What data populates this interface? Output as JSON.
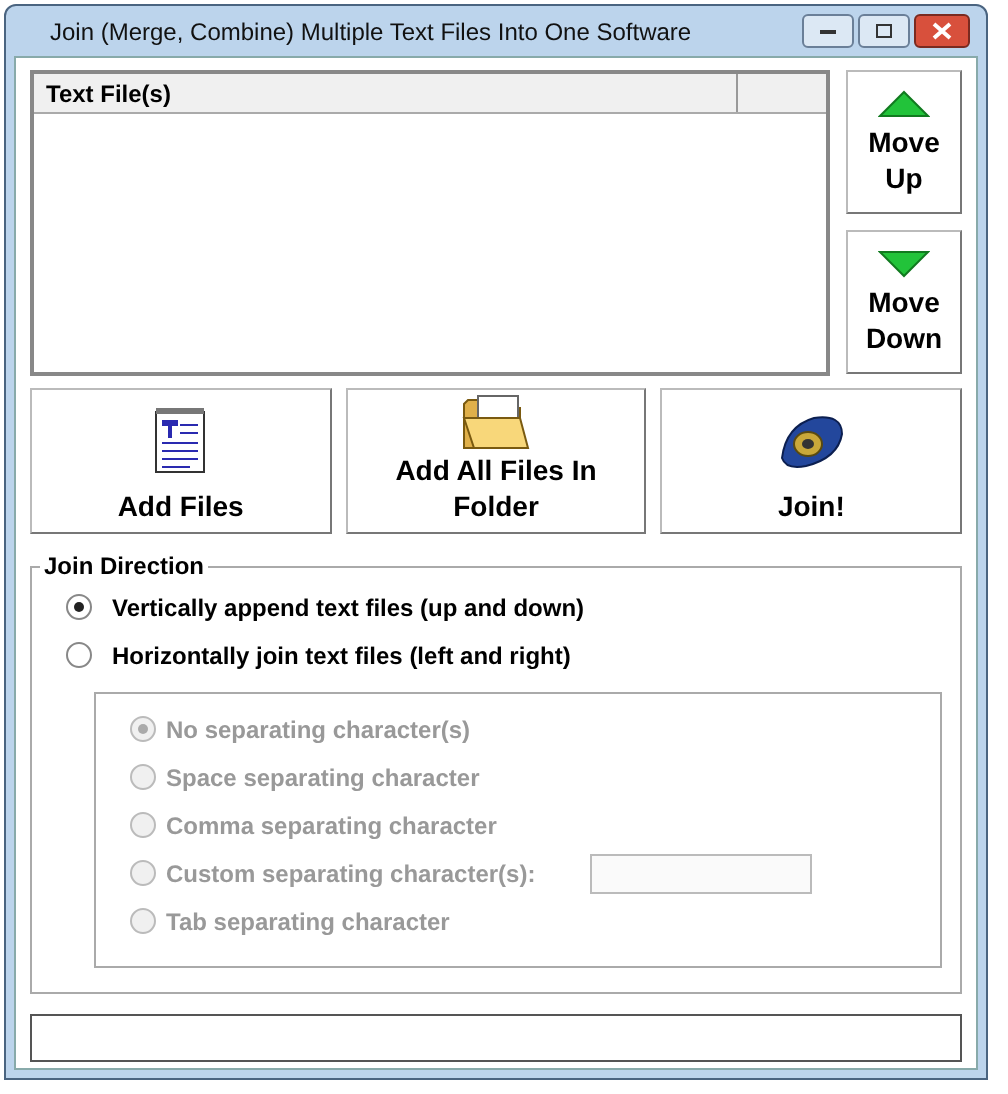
{
  "window": {
    "title": "Join (Merge, Combine) Multiple Text Files Into One Software"
  },
  "file_list": {
    "columns": [
      {
        "label": "Text File(s)"
      }
    ]
  },
  "side_buttons": [
    {
      "label": "Move Up",
      "kind": "up"
    },
    {
      "label": "Move Down",
      "kind": "down"
    }
  ],
  "action_buttons": [
    {
      "label": "Add Files",
      "kind": "document"
    },
    {
      "label": "Add All Files In Folder",
      "kind": "folder"
    },
    {
      "label": "Join!",
      "kind": "tape"
    }
  ],
  "join_direction": {
    "title": "Join Direction",
    "options": [
      {
        "label": "Vertically append text files (up and down)",
        "selected": true
      },
      {
        "label": "Horizontally join text files (left and right)",
        "selected": false
      }
    ]
  },
  "separators": {
    "disabled": true,
    "options": [
      {
        "label": "No separating character(s)",
        "selected": true,
        "kind": "plain"
      },
      {
        "label": "Space separating character",
        "selected": false,
        "kind": "plain"
      },
      {
        "label": "Comma separating character",
        "selected": false,
        "kind": "plain"
      },
      {
        "label": "Custom separating character(s):",
        "selected": false,
        "kind": "field"
      },
      {
        "label": "Tab separating character",
        "selected": false,
        "kind": "plain"
      }
    ]
  }
}
